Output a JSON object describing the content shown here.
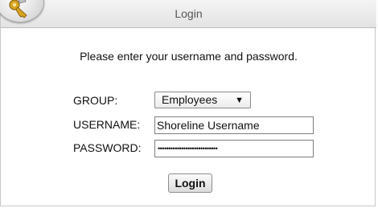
{
  "window": {
    "title": "Login",
    "logo_icon": "key-icon"
  },
  "form": {
    "instructions": "Please enter your username and password.",
    "group": {
      "label": "GROUP:",
      "selected": "Employees",
      "arrow": "▼"
    },
    "username": {
      "label": "USERNAME:",
      "value": "Shoreline Username"
    },
    "password": {
      "label": "PASSWORD:",
      "masked_value": "••••••••••••••••••••••••••••"
    },
    "submit_label": "Login"
  },
  "colors": {
    "titlebar": "#e8e8e8",
    "title_text": "#555555",
    "border": "#c8c8c8"
  }
}
